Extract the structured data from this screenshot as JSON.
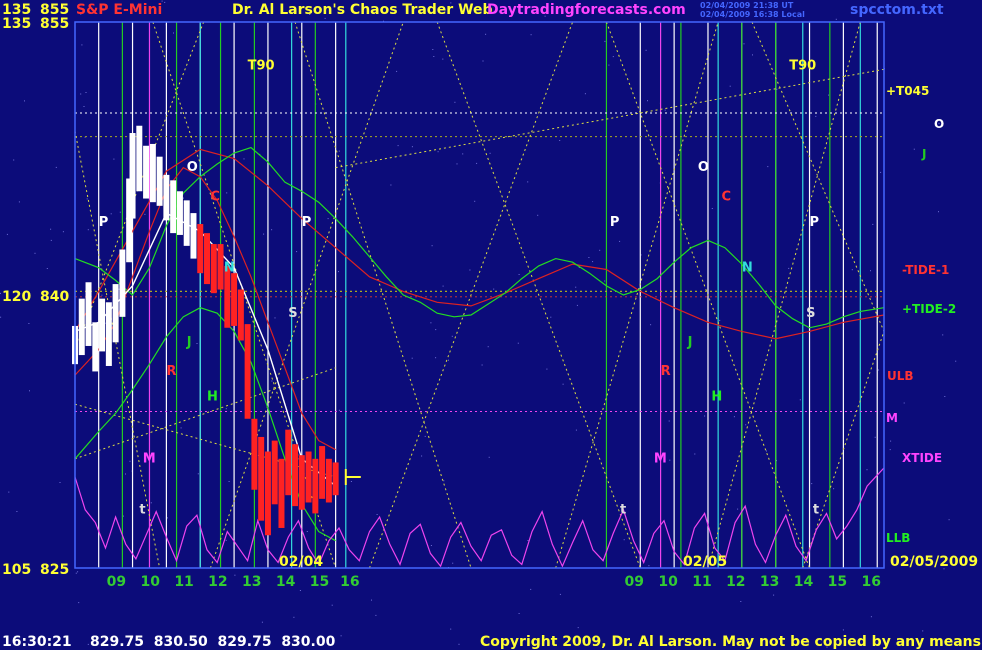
{
  "header": {
    "scale_top_left": "135",
    "price_top": "855",
    "instrument": "S&P E-Mini",
    "title": "Dr. Al Larson's Chaos Trader Web",
    "site": "Daytradingforecasts.com",
    "stamp_ut": "02/04/2009 21:38 UT",
    "stamp_local": "02/04/2009 16:38 Local",
    "filename": "spcctom.txt"
  },
  "footer": {
    "time": "16:30:21",
    "ohlc": "829.75  830.50  829.75  830.00",
    "copyright": "Copyright 2009, Dr. Al Larson. May not be copied by any means."
  },
  "colors": {
    "background": "#0c0c7a",
    "grid_white": "#ffffff",
    "grid_green": "#22cc22",
    "grid_cyan": "#33dddd",
    "grid_magenta": "#ee44ee",
    "price_white": "#ffffff",
    "price_red": "#ff2222",
    "tide_red": "#dd2222",
    "tide_green": "#22dd22",
    "xtide": "#ee44ee",
    "diag": "#dddd44",
    "text_yellow": "#ffff33",
    "text_magenta": "#ff44ff",
    "text_blue": "#4466ff"
  },
  "chart_data": {
    "type": "line",
    "title": "S&P E-Mini",
    "y_left_labels": [
      {
        "scale": "135",
        "price": "855",
        "value": 855
      },
      {
        "scale": "120",
        "price": "840",
        "value": 840
      },
      {
        "scale": "105",
        "price": "825",
        "value": 825
      }
    ],
    "ylim": [
      825,
      855
    ],
    "x_hour_labels": [
      "09",
      "10",
      "11",
      "12",
      "13",
      "14",
      "15",
      "16",
      "09",
      "10",
      "11",
      "12",
      "13",
      "14",
      "15",
      "16"
    ],
    "date_labels": [
      "02/04",
      "02/05",
      "02/05/2009"
    ],
    "xlim_hours": [
      8.3,
      32.2
    ],
    "right_labels": [
      {
        "text": "+T045",
        "color": "#ffff33"
      },
      {
        "text": "O",
        "color": "#ffffff"
      },
      {
        "text": "J",
        "color": "#22cc22"
      },
      {
        "text": "-TIDE-1",
        "color": "#ff3333"
      },
      {
        "text": "+TIDE-2",
        "color": "#22ee22"
      },
      {
        "text": "ULB",
        "color": "#ff3333"
      },
      {
        "text": "M",
        "color": "#ff44ff"
      },
      {
        "text": "XTIDE",
        "color": "#ff44ff"
      },
      {
        "text": "LLB",
        "color": "#22ee22"
      }
    ],
    "markers": [
      {
        "text": "T90",
        "x": 13.4,
        "y": 852.4,
        "color": "#ffff33"
      },
      {
        "text": "T90",
        "x": 29.4,
        "y": 852.4,
        "color": "#ffff33"
      },
      {
        "text": "P",
        "x": 9.0,
        "y": 843.8,
        "color": "#ffffff"
      },
      {
        "text": "P",
        "x": 15.0,
        "y": 843.8,
        "color": "#ffffff"
      },
      {
        "text": "P",
        "x": 24.1,
        "y": 843.8,
        "color": "#ffffff"
      },
      {
        "text": "P",
        "x": 30.0,
        "y": 843.8,
        "color": "#ffffff"
      },
      {
        "text": "O",
        "x": 11.6,
        "y": 846.8,
        "color": "#ffffff"
      },
      {
        "text": "O",
        "x": 26.7,
        "y": 846.8,
        "color": "#ffffff"
      },
      {
        "text": "C",
        "x": 12.3,
        "y": 845.2,
        "color": "#ff3333"
      },
      {
        "text": "C",
        "x": 27.4,
        "y": 845.2,
        "color": "#ff3333"
      },
      {
        "text": "N",
        "x": 12.7,
        "y": 841.3,
        "color": "#33dddd"
      },
      {
        "text": "N",
        "x": 28.0,
        "y": 841.3,
        "color": "#33dddd"
      },
      {
        "text": "S",
        "x": 14.6,
        "y": 838.8,
        "color": "#dddddd"
      },
      {
        "text": "S",
        "x": 29.9,
        "y": 838.8,
        "color": "#dddddd"
      },
      {
        "text": "J",
        "x": 11.6,
        "y": 837.2,
        "color": "#22cc22"
      },
      {
        "text": "J",
        "x": 26.4,
        "y": 837.2,
        "color": "#22cc22"
      },
      {
        "text": "R",
        "x": 11.0,
        "y": 835.6,
        "color": "#ff3333"
      },
      {
        "text": "R",
        "x": 25.6,
        "y": 835.6,
        "color": "#ff3333"
      },
      {
        "text": "H",
        "x": 12.2,
        "y": 834.2,
        "color": "#22ee22"
      },
      {
        "text": "H",
        "x": 27.1,
        "y": 834.2,
        "color": "#22ee22"
      },
      {
        "text": "M",
        "x": 10.3,
        "y": 830.8,
        "color": "#ff44ff"
      },
      {
        "text": "M",
        "x": 25.4,
        "y": 830.8,
        "color": "#ff44ff"
      },
      {
        "text": "t",
        "x": 10.2,
        "y": 828.0,
        "color": "#dddddd"
      },
      {
        "text": "t",
        "x": 24.4,
        "y": 828.0,
        "color": "#dddddd"
      },
      {
        "text": "t",
        "x": 30.1,
        "y": 828.0,
        "color": "#dddddd"
      }
    ],
    "series": [
      {
        "name": "price",
        "type": "bars",
        "color": "#ffffff",
        "x": [
          8.3,
          8.5,
          8.7,
          8.9,
          9.1,
          9.3,
          9.5,
          9.7,
          9.9,
          10.0,
          10.2,
          10.4,
          10.6,
          10.8,
          11.0,
          11.2,
          11.4,
          11.6,
          11.8,
          12.0,
          12.2,
          12.4,
          12.6,
          12.8,
          13.0,
          13.2,
          13.4,
          13.6,
          13.8,
          14.0,
          14.2,
          14.4,
          14.6,
          14.8,
          15.0,
          15.2,
          15.4,
          15.6,
          15.8,
          16.0
        ],
        "y": [
          837.0,
          838.5,
          839.2,
          837.2,
          838.1,
          837.7,
          838.8,
          840.5,
          843.7,
          846.5,
          847.5,
          846.8,
          847.2,
          846.2,
          845.3,
          844.8,
          844.6,
          844.2,
          843.3,
          842.7,
          842.2,
          841.3,
          841.7,
          840.0,
          839.8,
          839.0,
          836.0,
          831.5,
          829.8,
          829.1,
          830.2,
          829.3,
          830.8,
          830.0,
          829.6,
          829.8,
          829.4,
          830.1,
          829.8,
          829.9
        ],
        "lo": [
          836.2,
          836.7,
          837.2,
          835.8,
          836.9,
          836.1,
          837.4,
          838.8,
          841.8,
          844.2,
          845.7,
          845.3,
          845.1,
          844.9,
          844.1,
          843.4,
          843.3,
          842.7,
          842.0,
          841.2,
          840.6,
          840.1,
          840.3,
          838.2,
          838.3,
          837.5,
          833.2,
          829.3,
          827.6,
          826.8,
          828.5,
          827.2,
          829.0,
          828.4,
          828.2,
          828.6,
          828.0,
          828.8,
          828.6,
          829.0
        ],
        "hi": [
          838.3,
          839.8,
          840.7,
          838.5,
          839.8,
          839.6,
          840.6,
          842.5,
          846.4,
          848.9,
          849.3,
          848.2,
          848.3,
          847.6,
          846.6,
          846.3,
          845.7,
          845.2,
          844.5,
          843.9,
          843.4,
          842.8,
          842.8,
          841.6,
          841.2,
          840.3,
          838.4,
          833.2,
          832.2,
          831.4,
          832.0,
          831.0,
          832.6,
          831.8,
          831.2,
          831.4,
          831.0,
          831.7,
          831.0,
          830.8
        ]
      },
      {
        "name": "TIDE-1",
        "color": "#dd2222",
        "x": [
          8.3,
          9.0,
          10.0,
          11.0,
          12.0,
          13.0,
          14.0,
          15.0,
          16.0,
          17.0,
          18.0,
          19.0,
          20.0,
          21.0,
          22.0,
          23.0,
          24.0,
          25.0,
          26.0,
          27.0,
          28.0,
          29.0,
          30.0,
          31.0,
          32.2
        ],
        "y": [
          838.0,
          840.2,
          843.5,
          846.8,
          848.0,
          847.5,
          846.0,
          844.2,
          842.6,
          841.0,
          840.2,
          839.6,
          839.4,
          840.1,
          840.9,
          841.7,
          841.4,
          840.2,
          839.3,
          838.5,
          838.0,
          837.6,
          838.0,
          838.5,
          838.9
        ]
      },
      {
        "name": "TIDE-2",
        "color": "#22dd22",
        "x": [
          8.3,
          9.0,
          9.5,
          10.0,
          10.5,
          11.0,
          11.5,
          12.0,
          12.5,
          13.0,
          13.5,
          14.0,
          14.5,
          15.0,
          15.5,
          16.0,
          16.5,
          17.0,
          17.5,
          18.0,
          18.5,
          19.0,
          19.5,
          20.0,
          20.5,
          21.0,
          21.5,
          22.0,
          22.5,
          23.0,
          23.5,
          24.0,
          24.5,
          25.0,
          25.5,
          26.0,
          26.5,
          27.0,
          27.5,
          28.0,
          28.5,
          29.0,
          29.5,
          30.0,
          30.5,
          31.0,
          31.5,
          32.2
        ],
        "y": [
          842.0,
          841.5,
          840.8,
          840.0,
          841.5,
          843.8,
          845.6,
          846.5,
          847.2,
          847.8,
          848.1,
          847.3,
          846.2,
          845.7,
          845.1,
          844.2,
          843.2,
          842.1,
          841.0,
          840.0,
          839.6,
          839.0,
          838.8,
          838.9,
          839.5,
          840.1,
          840.9,
          841.6,
          842.0,
          841.8,
          841.2,
          840.5,
          840.0,
          840.3,
          840.9,
          841.8,
          842.6,
          843.0,
          842.6,
          841.7,
          840.6,
          839.4,
          838.7,
          838.2,
          838.4,
          838.8,
          839.1,
          839.3
        ]
      },
      {
        "name": "ULB",
        "color": "#dd2222",
        "x": [
          8.3,
          9.0,
          9.5,
          10.0,
          10.5,
          11.0,
          11.5,
          12.0,
          12.5,
          13.0,
          13.5,
          14.0,
          14.5,
          15.0,
          15.5,
          16.0
        ],
        "y": [
          835.6,
          837.0,
          838.5,
          841.0,
          843.5,
          845.8,
          847.0,
          846.5,
          845.2,
          843.2,
          841.0,
          838.5,
          836.0,
          833.5,
          832.0,
          831.5
        ]
      },
      {
        "name": "LLB",
        "color": "#22dd22",
        "x": [
          8.3,
          9.0,
          9.5,
          10.0,
          10.5,
          11.0,
          11.5,
          12.0,
          12.5,
          13.0,
          13.5,
          14.0,
          14.5,
          15.0,
          15.5,
          16.0
        ],
        "y": [
          831.0,
          832.5,
          833.5,
          834.8,
          836.2,
          837.7,
          838.8,
          839.3,
          839.0,
          838.0,
          836.3,
          833.8,
          831.0,
          828.5,
          827.0,
          826.5
        ]
      },
      {
        "name": "XTIDE",
        "color": "#ee44ee",
        "x": [
          8.3,
          8.6,
          8.9,
          9.2,
          9.5,
          9.8,
          10.1,
          10.4,
          10.7,
          11.0,
          11.3,
          11.6,
          11.9,
          12.2,
          12.5,
          12.8,
          13.1,
          13.4,
          13.7,
          14.0,
          14.3,
          14.6,
          14.9,
          15.2,
          15.5,
          15.8,
          16.1,
          16.4,
          16.7,
          17.0,
          17.3,
          17.6,
          17.9,
          18.2,
          18.5,
          18.8,
          19.1,
          19.4,
          19.7,
          20.0,
          20.3,
          20.6,
          20.9,
          21.2,
          21.5,
          21.8,
          22.1,
          22.4,
          22.7,
          23.0,
          23.3,
          23.6,
          23.9,
          24.2,
          24.5,
          24.8,
          25.1,
          25.4,
          25.7,
          26.0,
          26.3,
          26.6,
          26.9,
          27.2,
          27.5,
          27.8,
          28.1,
          28.4,
          28.7,
          29.0,
          29.3,
          29.6,
          29.9,
          30.2,
          30.5,
          30.8,
          31.1,
          31.4,
          31.7,
          32.0,
          32.2
        ],
        "y": [
          830.0,
          828.2,
          827.5,
          826.1,
          827.8,
          826.3,
          825.5,
          826.8,
          828.1,
          826.7,
          825.4,
          827.3,
          827.9,
          826.0,
          825.3,
          827.0,
          826.2,
          825.4,
          827.6,
          826.0,
          825.3,
          826.7,
          827.6,
          826.1,
          825.2,
          826.5,
          827.2,
          826.0,
          825.4,
          827.0,
          827.8,
          826.3,
          825.2,
          826.9,
          827.4,
          825.8,
          825.1,
          826.7,
          827.5,
          826.2,
          825.4,
          826.8,
          827.1,
          825.7,
          825.2,
          827.0,
          828.1,
          826.3,
          825.1,
          826.4,
          827.6,
          826.0,
          825.4,
          826.9,
          828.2,
          826.5,
          825.3,
          826.9,
          827.6,
          825.9,
          825.2,
          827.2,
          828.0,
          826.1,
          825.4,
          827.5,
          828.4,
          826.3,
          825.3,
          826.8,
          827.9,
          826.2,
          825.4,
          827.1,
          828.0,
          826.6,
          827.3,
          828.2,
          829.5,
          830.1,
          830.5
        ]
      },
      {
        "name": "Tline",
        "color": "#ffffff",
        "x": [
          8.3,
          9.0,
          10.0,
          11.0,
          12.0,
          13.0,
          14.0,
          15.0,
          16.0
        ],
        "y": [
          838.0,
          838.5,
          840.5,
          844.5,
          843.5,
          841.5,
          837.0,
          831.0,
          829.5
        ]
      }
    ]
  }
}
